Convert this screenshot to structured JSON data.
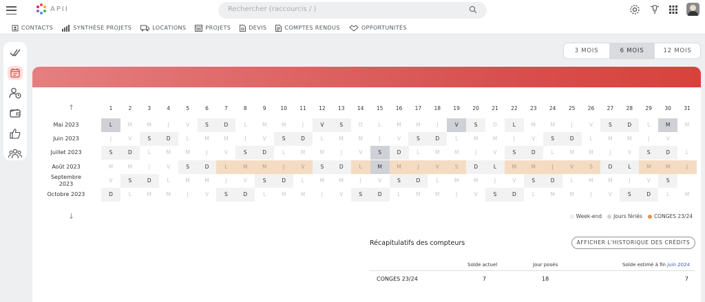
{
  "search": {
    "placeholder": "Rechercher (raccourcis / )"
  },
  "logo": {
    "text": "APII"
  },
  "nav": [
    {
      "icon": "contacts-icon",
      "label": "CONTACTS"
    },
    {
      "icon": "chart-icon",
      "label": "SYNTHÈSE PROJETS"
    },
    {
      "icon": "truck-icon",
      "label": "LOCATIONS"
    },
    {
      "icon": "projects-icon",
      "label": "PROJETS"
    },
    {
      "icon": "document-icon",
      "label": "DEVIS"
    },
    {
      "icon": "report-icon",
      "label": "COMPTES RENDUS"
    },
    {
      "icon": "handshake-icon",
      "label": "OPPORTUNITÉS"
    }
  ],
  "sidebar": [
    "tasks-icon",
    "calendar-icon",
    "user-clock-icon",
    "wallet-icon",
    "thumbs-up-icon",
    "team-icon"
  ],
  "period": [
    "3 MOIS",
    "6 MOIS",
    "12 MOIS"
  ],
  "period_active": 1,
  "days": [
    "1",
    "2",
    "3",
    "4",
    "5",
    "6",
    "7",
    "8",
    "9",
    "10",
    "11",
    "12",
    "13",
    "14",
    "15",
    "16",
    "17",
    "18",
    "19",
    "20",
    "21",
    "22",
    "23",
    "24",
    "25",
    "26",
    "27",
    "28",
    "29",
    "30",
    "31"
  ],
  "months": [
    {
      "label": "Mai 2023",
      "cells": "LMMJVSDLMMJVSDLMMJVSDLMMJVSDLMM",
      "types": "f....ww....ww.....fw.w....ww.f.."
    },
    {
      "label": "Juin 2023",
      "cells": "JVSDLMMJVSDLMMJVSDLMMJVSDLMMJV",
      "types": "..ww.....ww.....ww.....ww......"
    },
    {
      "label": "Juillet 2023",
      "cells": "SDLMMJVSDLMMJVSDLMMJVSDLMMJVSDL",
      "types": "ww.....ww.....fw.....ww.....ww."
    },
    {
      "label": "Août 2023",
      "cells": "MMJVSDLMMJVSDLMMJVSDLMMJVSDLMMJ",
      "types": "....wwcccccwwcfccccwwcccccwwcccc"
    },
    {
      "label": "Septembre 2023",
      "cells": "VSDLMMJVSDLMMJVSDLMMJVSDLMMJVS",
      "types": ".ww.....ww.....ww.....ww.....w"
    },
    {
      "label": "Octobre 2023",
      "cells": "DLMMJVSDLMMJVSDLMMJVSDLMMJVSDLM",
      "types": "w.....ww.....ww.....ww.....ww.."
    }
  ],
  "legend": [
    {
      "label": "Week-end",
      "color": "#f2f2f2"
    },
    {
      "label": "Jours fériés",
      "color": "#cfd1d6"
    },
    {
      "label": "CONGES 23/24",
      "color": "#e59143"
    }
  ],
  "recap": {
    "title": "Récapitulatifs des compteurs",
    "history_button": "AFFICHER L'HISTORIQUE DES CRÉDITS",
    "col_solde": "Solde actuel",
    "col_jours": "Jour posés",
    "col_estime": "Solde estimé à fin",
    "col_estime_month": "juin 2024",
    "rows": [
      {
        "name": "CONGES 23/24",
        "solde": "7",
        "jours": "18",
        "estime": "7"
      }
    ]
  },
  "colors": {
    "accent": "#d9423b",
    "holiday": "#cfd1d6",
    "conges": "#f4dcc3"
  }
}
